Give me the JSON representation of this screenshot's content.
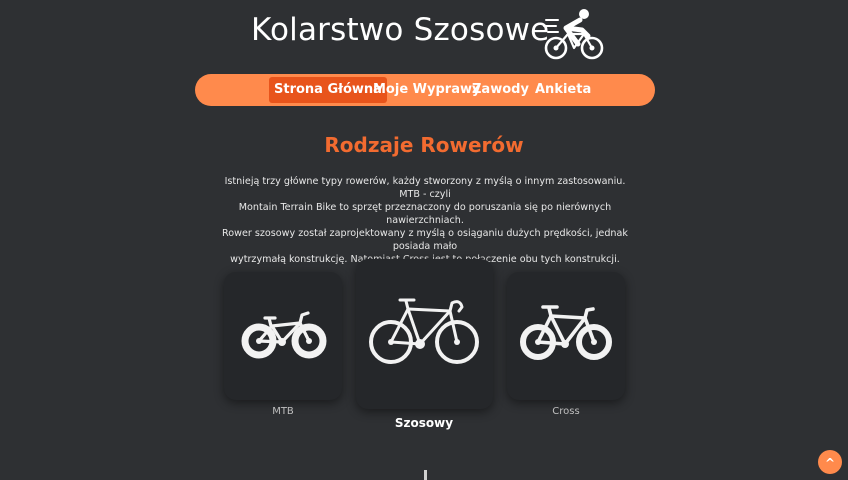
{
  "header": {
    "title": "Kolarstwo Szosowe",
    "logo_icon": "cyclist-icon"
  },
  "nav": {
    "items": [
      {
        "label": "Strona Główna",
        "active": true
      },
      {
        "label": "Moje Wyprawy",
        "active": false
      },
      {
        "label": "Zawody",
        "active": false
      },
      {
        "label": "Ankieta",
        "active": false
      }
    ]
  },
  "main": {
    "section_title": "Rodzaje Rowerów",
    "intro_lines": [
      "Istnieją trzy główne typy rowerów, każdy stworzony z myślą o innym zastosowaniu. MTB - czyli",
      "Montain Terrain Bike to sprzęt przeznaczony do poruszania się po nierównych nawierzchniach.",
      "Rower szosowy został zaprojektowany z myślą o osiąganiu dużych prędkości, jednak posiada mało",
      "wytrzymałą konstrukcję. Natomiast Cross jest to połączenie obu tych konstrukcji."
    ],
    "bikes": [
      {
        "label": "MTB",
        "icon": "mtb-bike-icon",
        "featured": false
      },
      {
        "label": "Szosowy",
        "icon": "road-bike-icon",
        "featured": true
      },
      {
        "label": "Cross",
        "icon": "cross-bike-icon",
        "featured": false
      }
    ]
  },
  "back_to_top": {
    "label": "^",
    "icon": "arrow-up-icon"
  },
  "colors": {
    "background": "#2e3033",
    "accent": "#ff8a4c",
    "accent_active": "#e8541b",
    "heading": "#f26b30",
    "card": "#25272a"
  }
}
